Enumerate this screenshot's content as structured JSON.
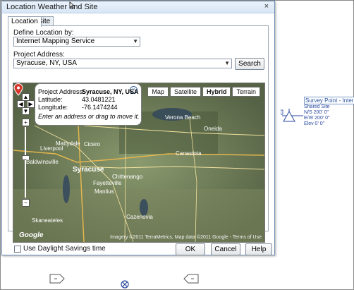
{
  "dialog": {
    "title": "Location Weather and Site",
    "close_glyph": "×",
    "tabs": [
      "Location",
      "Site"
    ],
    "define_label": "Define Location by:",
    "define_value": "Internet Mapping Service",
    "project_address_label": "Project Address:",
    "project_address_value": "Syracuse, NY, USA",
    "search_button": "Search",
    "daylight_label": "Use Daylight Savings time",
    "ok": "OK",
    "cancel": "Cancel",
    "help": "Help"
  },
  "map": {
    "view_buttons": [
      "Map",
      "Satellite",
      "Hybrid",
      "Terrain"
    ],
    "active_view": "Hybrid",
    "popup": {
      "project_address_label": "Project Address:",
      "project_address_value": "Syracuse, NY, USA",
      "latitude_label": "Latitude:",
      "latitude_value": "43.0481221",
      "longitude_label": "Longitude:",
      "longitude_value": "-76.1474244",
      "hint": "Enter an address or drag to move it."
    },
    "places": [
      "Verona Beach",
      "Oneida",
      "Canastota",
      "Syracuse",
      "Chittenango",
      "Fayetteville",
      "Manlius",
      "Cicero",
      "Liverpool",
      "Mattydale",
      "Cazenovia",
      "Baldwinsville",
      "Skaneateles"
    ],
    "logo": "Google",
    "attribution": "Imagery ©2011 TerraMetrics, Map data ©2011 Google - Terms of Use"
  },
  "survey_point": {
    "title": "Survey Point - Internal",
    "subtitle": "Shared Site",
    "ns": "N/S   200' 0\"",
    "ew": "E/W   200' 0\"",
    "elev": "Elev   0' 0\""
  }
}
